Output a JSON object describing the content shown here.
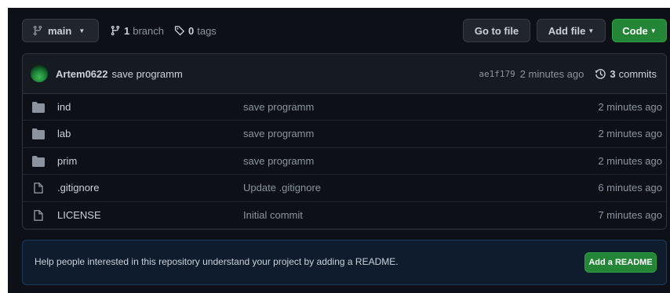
{
  "toolbar": {
    "branch_name": "main",
    "branch_count": "1",
    "branch_word": "branch",
    "tag_count": "0",
    "tag_word": "tags",
    "goto_label": "Go to file",
    "addfile_label": "Add file",
    "code_label": "Code"
  },
  "commit": {
    "author": "Artem0622",
    "message": "save programm",
    "sha": "ae1f179",
    "age": "2 minutes ago",
    "commits_count": "3",
    "commits_word": "commits"
  },
  "files": [
    {
      "name": "ind",
      "type": "folder",
      "message": "save programm",
      "age": "2 minutes ago"
    },
    {
      "name": "lab",
      "type": "folder",
      "message": "save programm",
      "age": "2 minutes ago"
    },
    {
      "name": "prim",
      "type": "folder",
      "message": "save programm",
      "age": "2 minutes ago"
    },
    {
      "name": ".gitignore",
      "type": "file",
      "message": "Update .gitignore",
      "age": "6 minutes ago"
    },
    {
      "name": "LICENSE",
      "type": "file",
      "message": "Initial commit",
      "age": "7 minutes ago"
    }
  ],
  "readme": {
    "text": "Help people interested in this repository understand your project by adding a README.",
    "button_label": "Add a README"
  },
  "colors": {
    "background": "#0d1117",
    "accent_green": "#238636",
    "folder": "#8b949e"
  }
}
